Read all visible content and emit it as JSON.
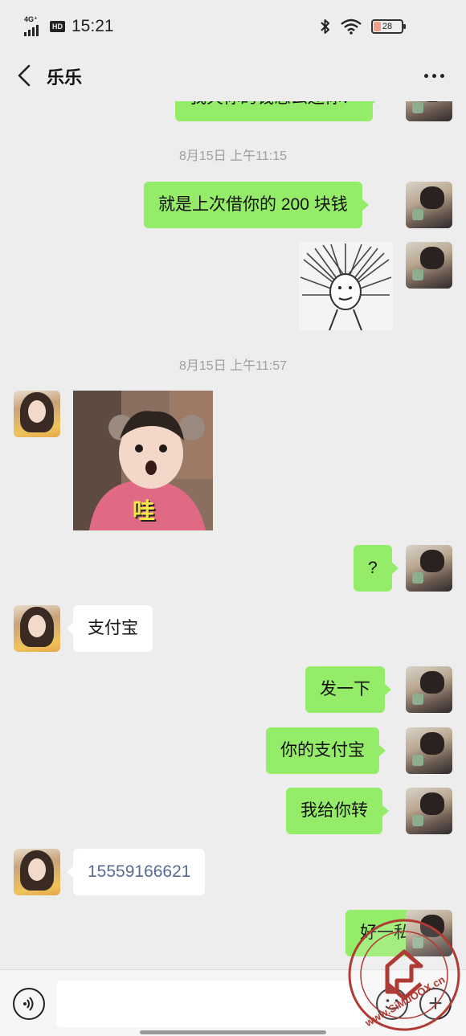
{
  "status_bar": {
    "network": "4G⁺",
    "hd": "HD",
    "time": "15:21",
    "battery": "28"
  },
  "header": {
    "title": "乐乐"
  },
  "timestamps": [
    "8月15日 上午11:15",
    "8月15日 上午11:57"
  ],
  "messages": [
    {
      "side": "out",
      "type": "text",
      "text": "我欠你的钱怎么还你？"
    },
    {
      "side": "out",
      "type": "text",
      "text": "就是上次借你的 200 块钱"
    },
    {
      "side": "out",
      "type": "sticker",
      "icon": "spiky-hair-face-sticker"
    },
    {
      "side": "in",
      "type": "image",
      "icon": "surprised-child-photo",
      "caption": "哇"
    },
    {
      "side": "out",
      "type": "text",
      "text": "?"
    },
    {
      "side": "in",
      "type": "text",
      "text": "支付宝"
    },
    {
      "side": "out",
      "type": "text",
      "text": "发一下"
    },
    {
      "side": "out",
      "type": "text",
      "text": "你的支付宝"
    },
    {
      "side": "out",
      "type": "text",
      "text": "我给你转"
    },
    {
      "side": "in",
      "type": "text",
      "text": "15559166621"
    },
    {
      "side": "out",
      "type": "text",
      "text": "好一私"
    }
  ],
  "watermark": {
    "text": "www.SiMuOOX.cn"
  },
  "colors": {
    "outgoing_bubble": "#95ec69",
    "incoming_bubble": "#ffffff",
    "background": "#ededed",
    "link": "#576b95"
  }
}
